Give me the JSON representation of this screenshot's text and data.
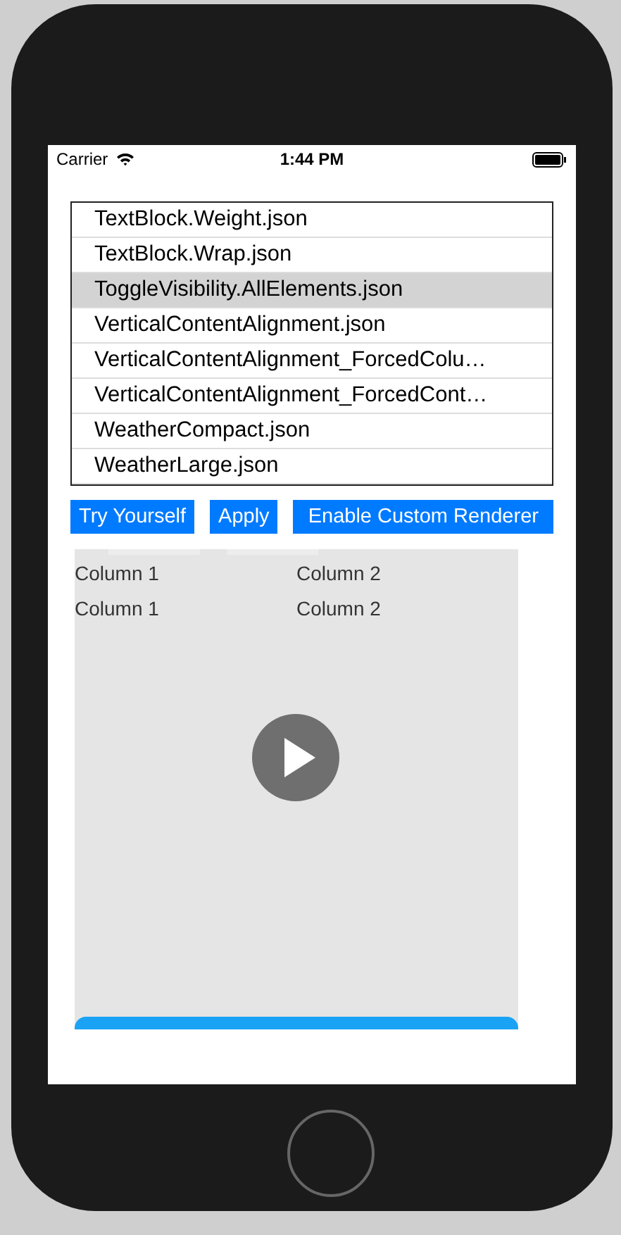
{
  "status_bar": {
    "carrier": "Carrier",
    "time": "1:44 PM"
  },
  "files": [
    {
      "name": "TextBlock.Weight.json",
      "selected": false
    },
    {
      "name": "TextBlock.Wrap.json",
      "selected": false
    },
    {
      "name": "ToggleVisibility.AllElements.json",
      "selected": true
    },
    {
      "name": "VerticalContentAlignment.json",
      "selected": false
    },
    {
      "name": "VerticalContentAlignment_ForcedColu…",
      "selected": false
    },
    {
      "name": "VerticalContentAlignment_ForcedCont…",
      "selected": false
    },
    {
      "name": "WeatherCompact.json",
      "selected": false
    },
    {
      "name": "WeatherLarge.json",
      "selected": false
    }
  ],
  "buttons": [
    "Try Yourself",
    "Apply",
    "Enable Custom Renderer"
  ],
  "card": {
    "rows": [
      [
        "Column 1",
        "Column 2"
      ],
      [
        "Column 1",
        "Column 2"
      ]
    ]
  }
}
